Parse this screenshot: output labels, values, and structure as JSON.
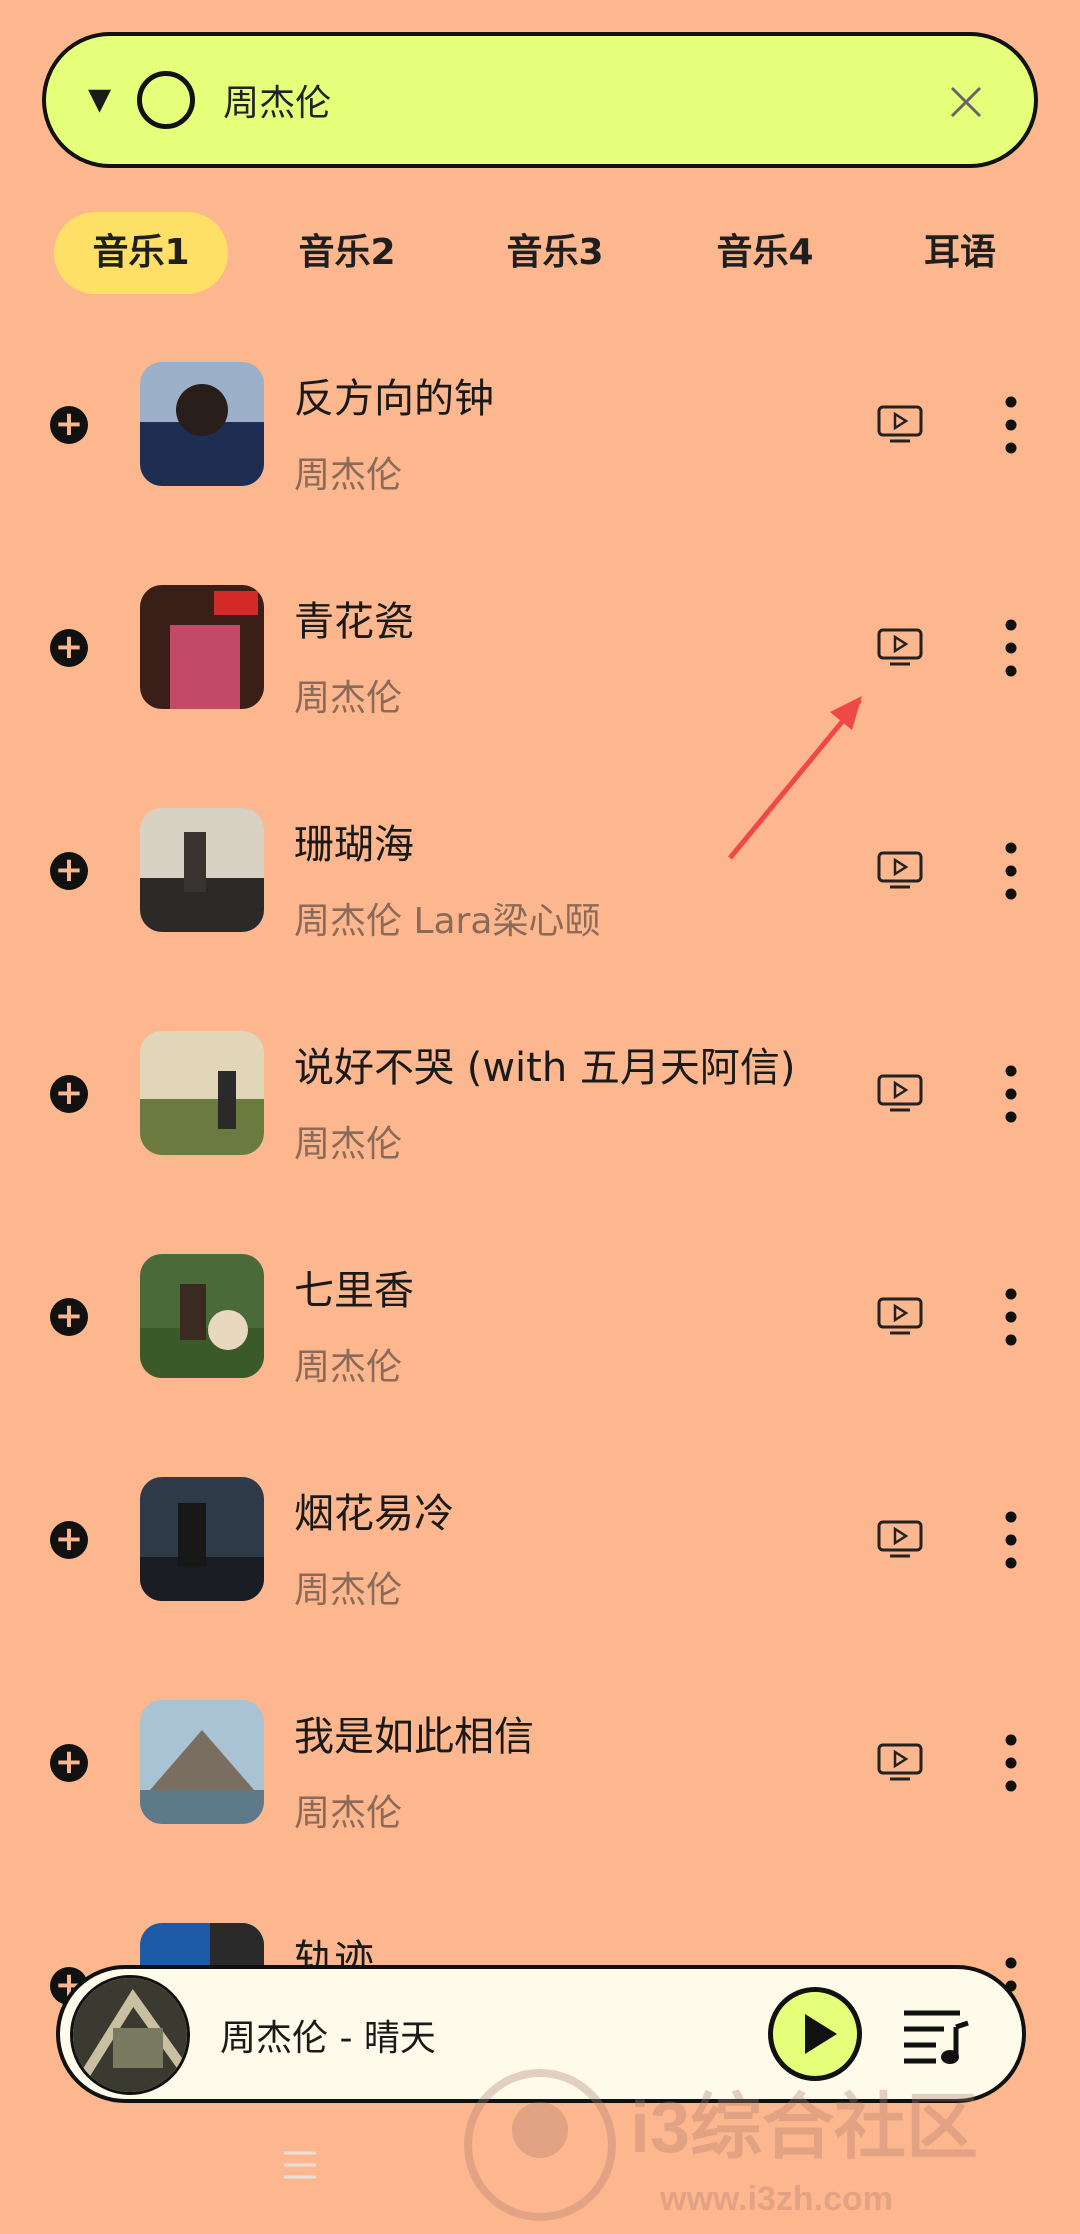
{
  "search": {
    "query": "周杰伦"
  },
  "tabs": [
    {
      "label": "音乐1",
      "active": true
    },
    {
      "label": "音乐2",
      "active": false
    },
    {
      "label": "音乐3",
      "active": false
    },
    {
      "label": "音乐4",
      "active": false
    },
    {
      "label": "耳语",
      "active": false
    }
  ],
  "songs": [
    {
      "title": "反方向的钟",
      "artist": "周杰伦"
    },
    {
      "title": "青花瓷",
      "artist": "周杰伦"
    },
    {
      "title": "珊瑚海",
      "artist": "周杰伦 Lara梁心颐"
    },
    {
      "title": "说好不哭 (with 五月天阿信)",
      "artist": "周杰伦"
    },
    {
      "title": "七里香",
      "artist": "周杰伦"
    },
    {
      "title": "烟花易冷",
      "artist": "周杰伦"
    },
    {
      "title": "我是如此相信",
      "artist": "周杰伦"
    },
    {
      "title": "轨迹",
      "artist": ""
    }
  ],
  "player": {
    "now_playing": "周杰伦 - 晴天"
  },
  "watermark": {
    "brand": "i3综合社区",
    "url": "www.i3zh.com"
  },
  "colors": {
    "background": "#FDB78E",
    "search_bg": "#E6FF7A",
    "tab_active": "#FFE066",
    "player_bg": "#FFFBEA"
  }
}
